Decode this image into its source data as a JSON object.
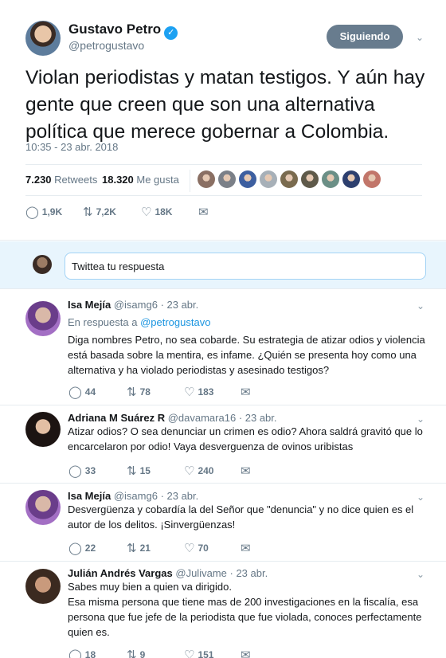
{
  "main_tweet": {
    "author_name": "Gustavo Petro",
    "verified_glyph": "✓",
    "handle": "@petrogustavo",
    "follow_label": "Siguiendo",
    "text": "Violan periodistas y matan testigos. Y aún hay gente que creen que son una alternativa política que merece gobernar a Colombia.",
    "timestamp": "10:35 - 23 abr. 2018",
    "retweets_count": "7.230",
    "retweets_label": "Retweets",
    "likes_count": "18.320",
    "likes_label": "Me gusta",
    "reply_count": "1,9K",
    "retweet_count_short": "7,2K",
    "like_count_short": "18K",
    "liker_avatar_colors": [
      "#8a6f63",
      "#7b8088",
      "#3d5fa0",
      "#a7b0b8",
      "#7a6b4f",
      "#5f5a4a",
      "#6b8f86",
      "#2d3f6e",
      "#c2766a"
    ]
  },
  "reply_box": {
    "placeholder": "Twittea tu respuesta"
  },
  "replies": [
    {
      "name": "Isa Mejía",
      "handle": "@isamg6",
      "time": "· 23 abr.",
      "context_prefix": "En respuesta a",
      "context_handle": "@petrogustavo",
      "text": "Diga nombres Petro, no sea cobarde. Su estrategia de atizar odios y violencia está basada sobre la mentira, es infame. ¿Quién se presenta hoy como una alternativa y ha violado periodistas y asesinado testigos?",
      "replies": "44",
      "retweets": "78",
      "likes": "183"
    },
    {
      "name": "Adriana M Suárez R",
      "handle": "@davamara16",
      "time": "· 23 abr.",
      "text": "Atizar odios? O sea denunciar un crimen es odio? Ahora saldrá gravitó que lo encarcelaron por odio! Vaya desverguenza de ovinos uribistas",
      "replies": "33",
      "retweets": "15",
      "likes": "240"
    },
    {
      "name": "Isa Mejía",
      "handle": "@isamg6",
      "time": "· 23 abr.",
      "text": "Desvergüenza y cobardía la del Señor que \"denuncia\" y no dice quien es el autor de los delitos. ¡Sinvergüenzas!",
      "replies": "22",
      "retweets": "21",
      "likes": "70"
    },
    {
      "name": "Julián Andrés Vargas",
      "handle": "@Julivame",
      "time": "· 23 abr.",
      "text_line1": "Sabes muy bien a quien va dirigido.",
      "text_line2": "Esa misma persona que tiene mas de 200 investigaciones en la fiscalía, esa persona que fue jefe de la periodista que fue violada, conoces perfectamente quien es.",
      "replies": "18",
      "retweets": "9",
      "likes": "151"
    }
  ],
  "icons": {
    "reply": "reply-icon",
    "retweet": "retweet-icon",
    "like": "heart-icon",
    "dm": "envelope-icon",
    "menu": "chevron-down-icon"
  },
  "colors": {
    "accent": "#1da1f2",
    "link": "#1b95e0",
    "muted": "#657786",
    "follow_bg": "#687c8e",
    "reply_box_bg": "#e8f5fd"
  }
}
